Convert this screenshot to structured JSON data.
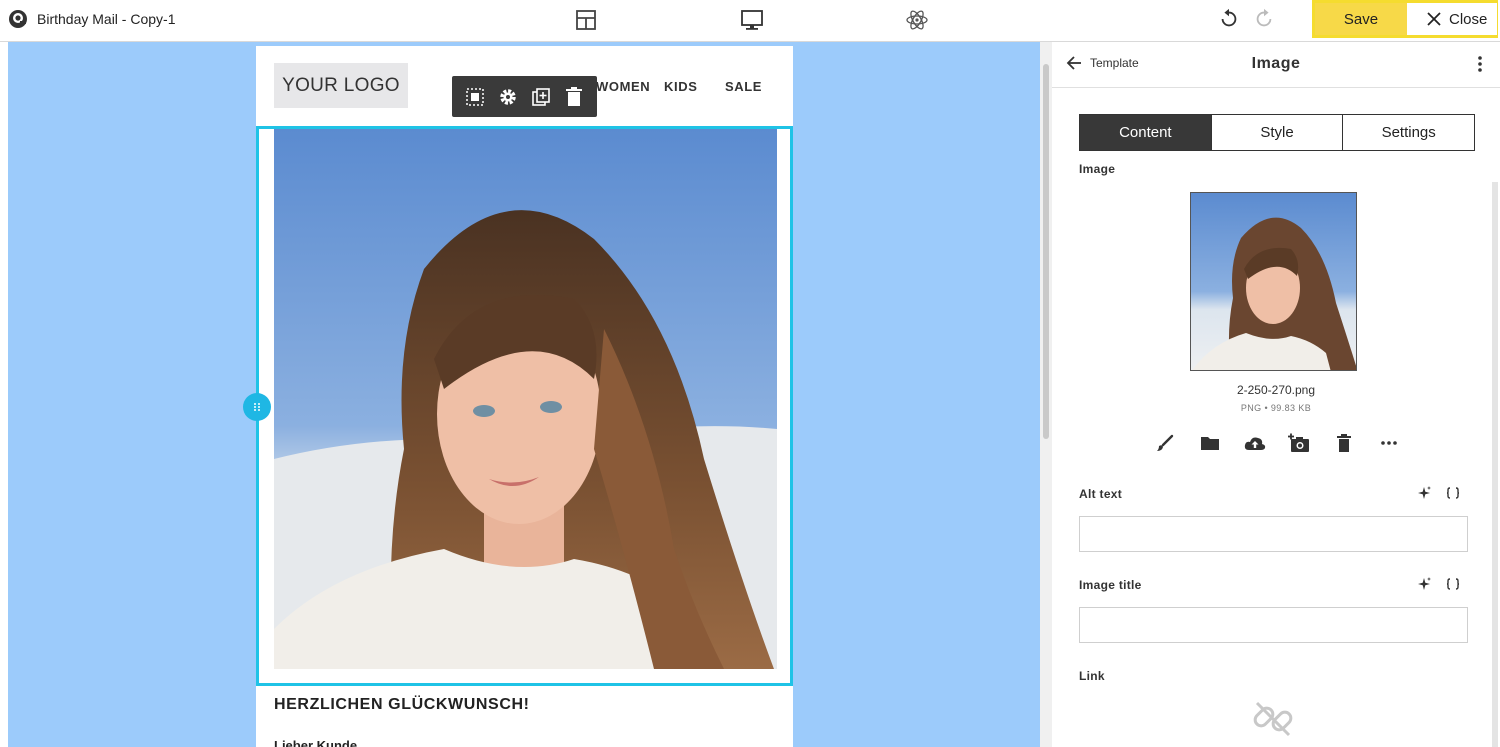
{
  "topbar": {
    "title": "Birthday Mail - Copy-1",
    "save_label": "Save",
    "close_label": "Close"
  },
  "email": {
    "logo_text": "YOUR LOGO",
    "nav": [
      "WOMEN",
      "KIDS",
      "SALE"
    ],
    "heading": "HERZLICHEN GLÜCKWUNSCH!",
    "greeting": "Lieber Kunde,"
  },
  "panel": {
    "back_label": "Template",
    "title": "Image",
    "tabs": [
      "Content",
      "Style",
      "Settings"
    ],
    "active_tab": "Content",
    "image_section_label": "Image",
    "file_name": "2-250-270.png",
    "file_meta": "PNG • 99.83 KB",
    "alt_text_label": "Alt text",
    "alt_text_value": "",
    "image_title_label": "Image title",
    "image_title_value": "",
    "link_label": "Link"
  },
  "colors": {
    "canvas_bg": "#9ccbfb",
    "selection": "#1fc3e6",
    "save_button": "#f7d948",
    "highlight_border": "#f5dc2f",
    "toolbar_bg": "#3a3a3a"
  },
  "icons": {
    "app": "app-logo-icon",
    "layout": "layout-icon",
    "desktop": "desktop-preview-icon",
    "ai": "atom-icon",
    "undo": "undo-icon",
    "redo": "redo-icon",
    "close": "close-icon",
    "block_tools": [
      "select-block-icon",
      "settings-gear-icon",
      "duplicate-icon",
      "delete-icon"
    ],
    "image_tools": [
      "brush-icon",
      "folder-icon",
      "upload-cloud-icon",
      "add-camera-icon",
      "delete-icon",
      "more-horizontal-icon"
    ]
  }
}
